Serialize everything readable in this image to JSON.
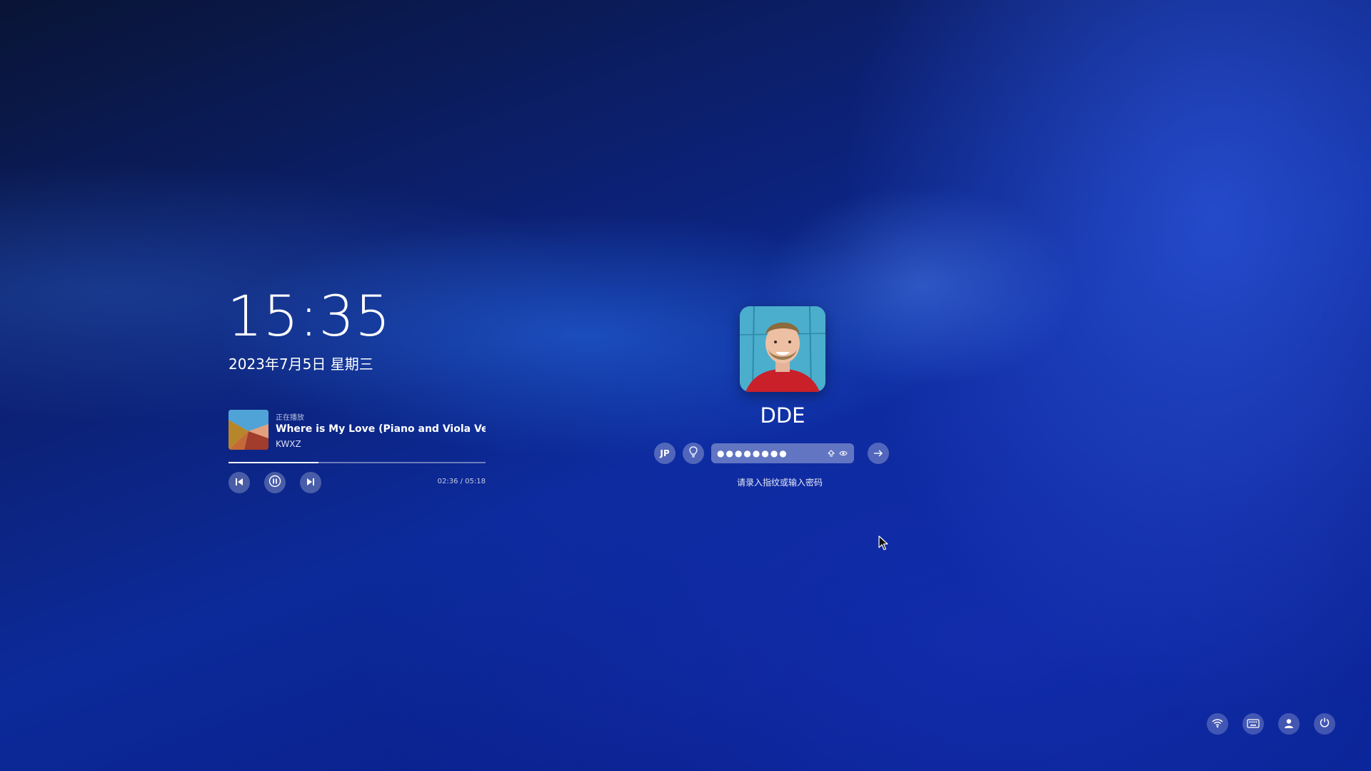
{
  "clock": {
    "time": "15:35",
    "date": "2023年7月5日 星期三"
  },
  "media": {
    "status_label": "正在播放",
    "title": "Where is My Love (Piano and Viola Version)..",
    "artist": "KWXZ",
    "elapsed": "02:36",
    "duration": "05:18",
    "time_readout": "02:36 / 05:18",
    "progress_fraction": 0.35,
    "controls": [
      "previous-icon",
      "pause-icon",
      "next-icon"
    ]
  },
  "login": {
    "username": "DDE",
    "keyboard_layout": "JP",
    "password_mask": "●●●●●●●●",
    "tip": "请录入指纹或输入密码",
    "icons": [
      "lightbulb-icon",
      "caps-lock-icon",
      "eye-icon",
      "arrow-right-icon"
    ]
  },
  "tray": {
    "icons": [
      "wifi-icon",
      "keyboard-icon",
      "user-icon",
      "power-icon"
    ]
  },
  "colors": {
    "background_dark": "#091435",
    "background_blue": "#0c2a9a",
    "accent_highlight": "#2f6fe8",
    "text": "#ffffff"
  }
}
